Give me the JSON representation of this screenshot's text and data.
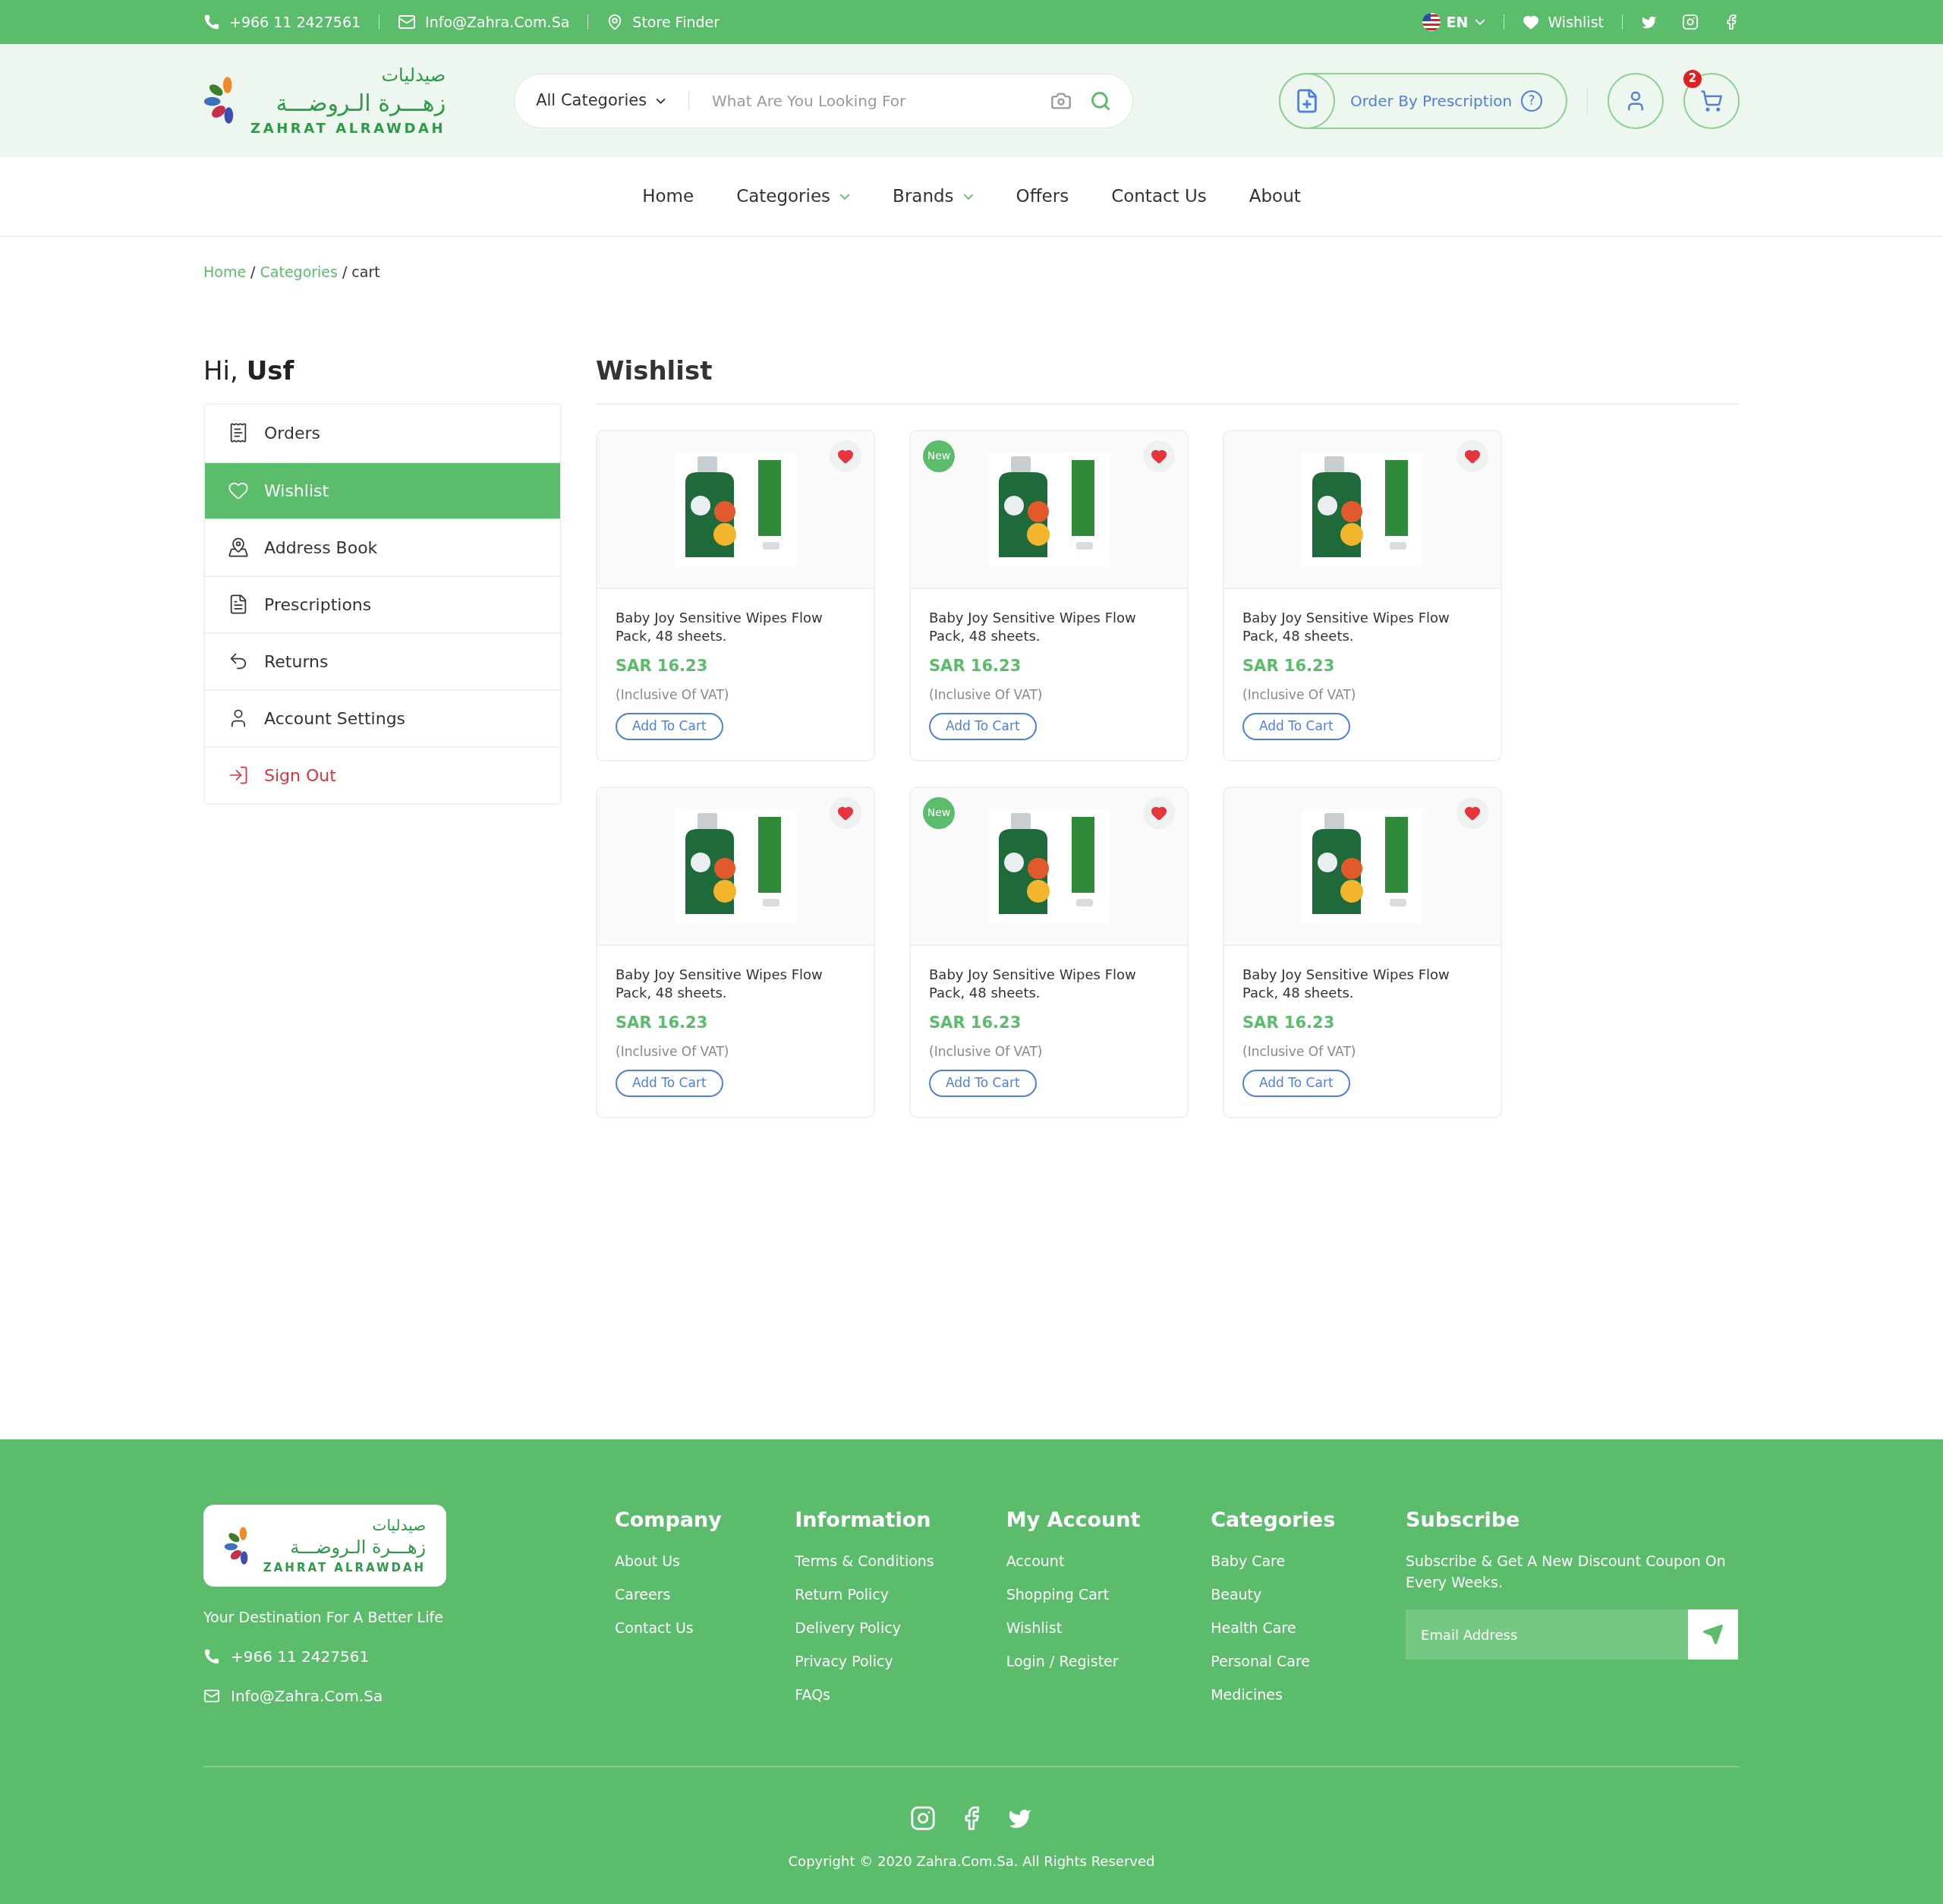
{
  "top_bar": {
    "phone": "+966 11 2427561",
    "email": "Info@Zahra.Com.Sa",
    "store_finder": "Store Finder",
    "language": "EN",
    "wishlist": "Wishlist"
  },
  "header": {
    "logo": {
      "arabic_top": "صيدليات",
      "arabic_main": "زهـــرة الـروضـــة",
      "latin": "ZAHRAT ALRAWDAH"
    },
    "search": {
      "category": "All Categories",
      "placeholder": "What Are You Looking For"
    },
    "prescription_button": "Order By Prescription",
    "help": "?",
    "cart_count": "2"
  },
  "nav": [
    {
      "label": "Home",
      "dropdown": false
    },
    {
      "label": "Categories",
      "dropdown": true
    },
    {
      "label": "Brands",
      "dropdown": true
    },
    {
      "label": "Offers",
      "dropdown": false
    },
    {
      "label": "Contact Us",
      "dropdown": false
    },
    {
      "label": "About",
      "dropdown": false
    }
  ],
  "breadcrumb": [
    {
      "kind": "link",
      "label": "Home"
    },
    {
      "kind": "separator",
      "label": "/"
    },
    {
      "kind": "link",
      "label": "Categories"
    },
    {
      "kind": "separator",
      "label": "/"
    },
    {
      "kind": "current",
      "label": "cart"
    }
  ],
  "greeting": {
    "prefix": "Hi,",
    "name": "Usf"
  },
  "sidebar": {
    "items": [
      {
        "label": "Orders",
        "kind": "link",
        "selected": false
      },
      {
        "label": "Wishlist",
        "kind": "link",
        "selected": true
      },
      {
        "label": "Address Book",
        "kind": "link",
        "selected": false
      },
      {
        "label": "Prescriptions",
        "kind": "link",
        "selected": false
      },
      {
        "label": "Returns",
        "kind": "link",
        "selected": false
      },
      {
        "label": "Account Settings",
        "kind": "link",
        "selected": false
      },
      {
        "label": "Sign Out",
        "kind": "signout",
        "selected": false
      }
    ]
  },
  "page_title": "Wishlist",
  "products": [
    {
      "name": "Baby Joy Sensitive Wipes Flow Pack, 48 sheets.",
      "price": "SAR 16.23",
      "vat_note": "(Inclusive Of VAT)",
      "button": "Add To Cart",
      "favorite": true
    },
    {
      "badge": "New",
      "name": "Baby Joy Sensitive Wipes Flow Pack, 48 sheets.",
      "price": "SAR 16.23",
      "vat_note": "(Inclusive Of VAT)",
      "button": "Add To Cart",
      "favorite": true
    },
    {
      "name": "Baby Joy Sensitive Wipes Flow Pack, 48 sheets.",
      "price": "SAR 16.23",
      "vat_note": "(Inclusive Of VAT)",
      "button": "Add To Cart",
      "favorite": true
    },
    {
      "name": "Baby Joy Sensitive Wipes Flow Pack, 48 sheets.",
      "price": "SAR 16.23",
      "vat_note": "(Inclusive Of VAT)",
      "button": "Add To Cart",
      "favorite": true
    },
    {
      "badge": "New",
      "name": "Baby Joy Sensitive Wipes Flow Pack, 48 sheets.",
      "price": "SAR 16.23",
      "vat_note": "(Inclusive Of VAT)",
      "button": "Add To Cart",
      "favorite": true
    },
    {
      "name": "Baby Joy Sensitive Wipes Flow Pack, 48 sheets.",
      "price": "SAR 16.23",
      "vat_note": "(Inclusive Of VAT)",
      "button": "Add To Cart",
      "favorite": true
    }
  ],
  "footer": {
    "logo": {
      "arabic_top": "صيدليات",
      "arabic_main": "زهـــرة الـروضـــة",
      "latin": "ZAHRAT ALRAWDAH"
    },
    "tagline": "Your Destination For A Better Life",
    "phone": "+966 11 2427561",
    "email": "Info@Zahra.Com.Sa",
    "columns": [
      {
        "title": "Company",
        "links": [
          "About Us",
          "Careers",
          "Contact Us"
        ]
      },
      {
        "title": "Information",
        "links": [
          "Terms & Conditions",
          "Return Policy",
          "Delivery Policy",
          "Privacy Policy",
          "FAQs"
        ]
      },
      {
        "title": "My Account",
        "links": [
          "Account",
          "Shopping Cart",
          "Wishlist",
          "Login / Register"
        ]
      },
      {
        "title": "Categories",
        "links": [
          "Baby Care",
          "Beauty",
          "Health Care",
          "Personal Care",
          "Medicines"
        ]
      }
    ],
    "subscribe": {
      "title": "Subscribe",
      "text": "Subscribe & Get A New Discount Coupon On Every Weeks.",
      "placeholder": "Email Address"
    },
    "copyright": "Copyright © 2020 Zahra.Com.Sa. All Rights Reserved"
  }
}
